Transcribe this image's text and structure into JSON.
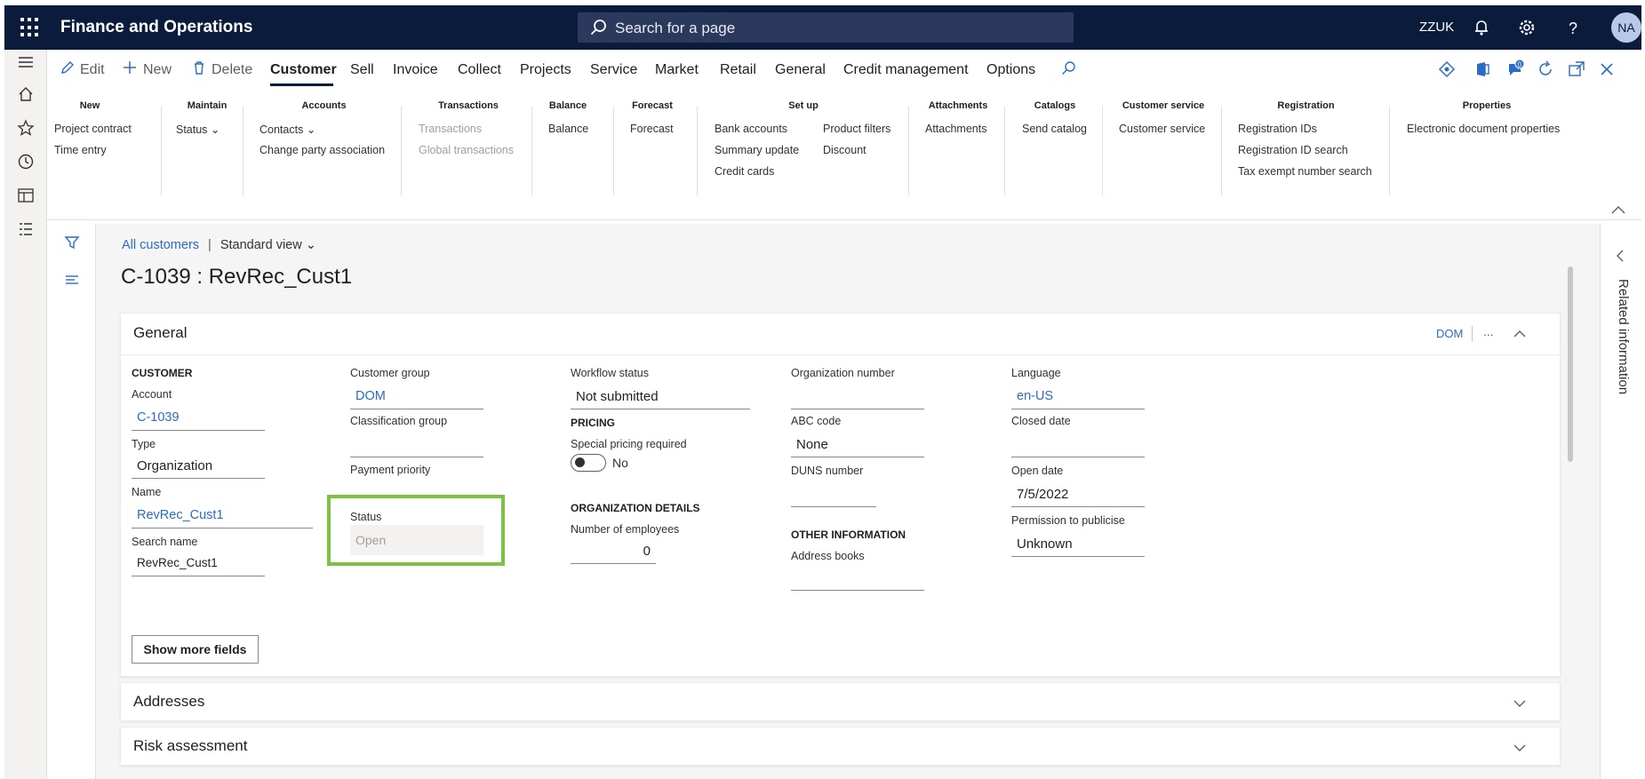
{
  "app": {
    "title": "Finance and Operations",
    "company": "ZZUK",
    "avatar_initials": "NA"
  },
  "search": {
    "placeholder": "Search for a page"
  },
  "actions": {
    "edit": "Edit",
    "new": "New",
    "delete": "Delete",
    "tabs": [
      "Customer",
      "Sell",
      "Invoice",
      "Collect",
      "Projects",
      "Service",
      "Market",
      "Retail",
      "General",
      "Credit management",
      "Options"
    ],
    "active_tab": "Customer",
    "notification_count": "0"
  },
  "ribbon": {
    "new": {
      "header": "New",
      "items": [
        "Project contract",
        "Time entry"
      ]
    },
    "maintain": {
      "header": "Maintain",
      "items": [
        "Status"
      ]
    },
    "accounts": {
      "header": "Accounts",
      "items": [
        "Contacts",
        "Change party association"
      ]
    },
    "transactions": {
      "header": "Transactions",
      "items": [
        "Transactions",
        "Global transactions"
      ]
    },
    "balance": {
      "header": "Balance",
      "items": [
        "Balance"
      ]
    },
    "forecast": {
      "header": "Forecast",
      "items": [
        "Forecast"
      ]
    },
    "setup": {
      "header": "Set up",
      "items": [
        "Bank accounts",
        "Summary update",
        "Credit cards",
        "Product filters",
        "Discount"
      ]
    },
    "attachments": {
      "header": "Attachments",
      "items": [
        "Attachments"
      ]
    },
    "catalogs": {
      "header": "Catalogs",
      "items": [
        "Send catalog"
      ]
    },
    "customer_service": {
      "header": "Customer service",
      "items": [
        "Customer service"
      ]
    },
    "registration": {
      "header": "Registration",
      "items": [
        "Registration IDs",
        "Registration ID search",
        "Tax exempt number search"
      ]
    },
    "properties": {
      "header": "Properties",
      "items": [
        "Electronic document properties"
      ]
    }
  },
  "breadcrumb": {
    "link": "All customers",
    "separator": "|",
    "view": "Standard view"
  },
  "page_title": "C-1039 : RevRec_Cust1",
  "general": {
    "header": "General",
    "tag": "DOM",
    "more": "...",
    "customer_section": "CUSTOMER",
    "account": {
      "label": "Account",
      "value": "C-1039"
    },
    "type": {
      "label": "Type",
      "value": "Organization"
    },
    "name": {
      "label": "Name",
      "value": "RevRec_Cust1"
    },
    "search_name": {
      "label": "Search name",
      "value": "RevRec_Cust1"
    },
    "customer_group": {
      "label": "Customer group",
      "value": "DOM"
    },
    "classification_group": {
      "label": "Classification group",
      "value": ""
    },
    "payment_priority": {
      "label": "Payment priority"
    },
    "status": {
      "label": "Status",
      "value": "Open"
    },
    "workflow_status": {
      "label": "Workflow status",
      "value": "Not submitted"
    },
    "pricing_section": "PRICING",
    "special_pricing": {
      "label": "Special pricing required",
      "value": "No"
    },
    "org_details_section": "ORGANIZATION DETAILS",
    "employees": {
      "label": "Number of employees",
      "value": "0"
    },
    "org_number": {
      "label": "Organization number",
      "value": ""
    },
    "abc_code": {
      "label": "ABC code",
      "value": "None"
    },
    "duns": {
      "label": "DUNS number",
      "value": ""
    },
    "other_info_section": "OTHER INFORMATION",
    "address_books": {
      "label": "Address books",
      "value": ""
    },
    "language": {
      "label": "Language",
      "value": "en-US"
    },
    "closed_date": {
      "label": "Closed date",
      "value": ""
    },
    "open_date": {
      "label": "Open date",
      "value": "7/5/2022"
    },
    "permission": {
      "label": "Permission to publicise",
      "value": "Unknown"
    },
    "show_more": "Show more fields"
  },
  "sections": {
    "addresses": "Addresses",
    "risk": "Risk assessment"
  },
  "related": {
    "label": "Related information"
  }
}
